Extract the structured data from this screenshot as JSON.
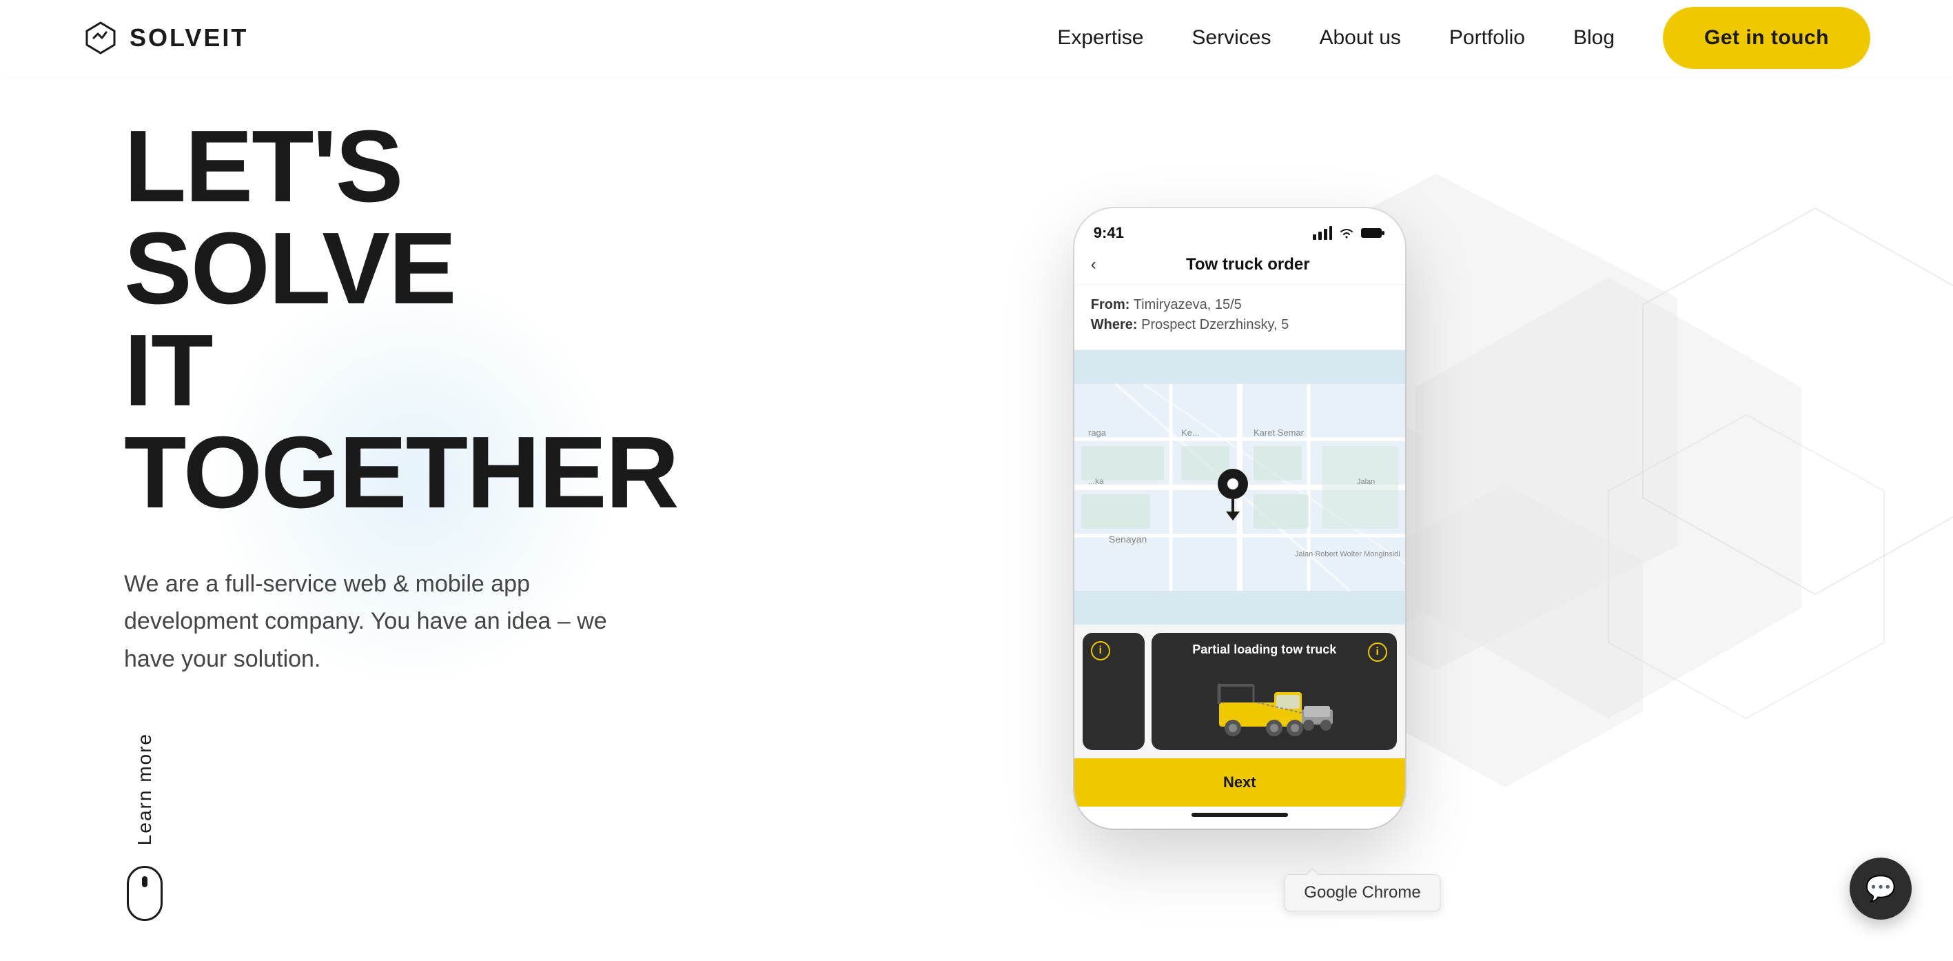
{
  "nav": {
    "logo_text": "SOLVEIT",
    "links": [
      {
        "id": "expertise",
        "label": "Expertise"
      },
      {
        "id": "services",
        "label": "Services"
      },
      {
        "id": "about",
        "label": "About us"
      },
      {
        "id": "portfolio",
        "label": "Portfolio"
      },
      {
        "id": "blog",
        "label": "Blog"
      }
    ],
    "cta_label": "Get in touch"
  },
  "hero": {
    "title_line1": "LET'S SOLVE",
    "title_line2": "IT TOGETHER",
    "subtitle": "We are a full-service web & mobile app development company. You have an idea – we have your solution.",
    "learn_more": "Learn more"
  },
  "phone": {
    "status_time": "9:41",
    "title": "Tow truck order",
    "from_label": "From:",
    "from_value": "Timiryazeva, 15/5",
    "where_label": "Where:",
    "where_value": "Prospect Dzerzhinsky, 5",
    "card_active_label": "Partial loading tow truck",
    "next_button": "Next"
  },
  "chat": {
    "icon": "💬"
  },
  "tooltip": {
    "label": "Google Chrome"
  }
}
